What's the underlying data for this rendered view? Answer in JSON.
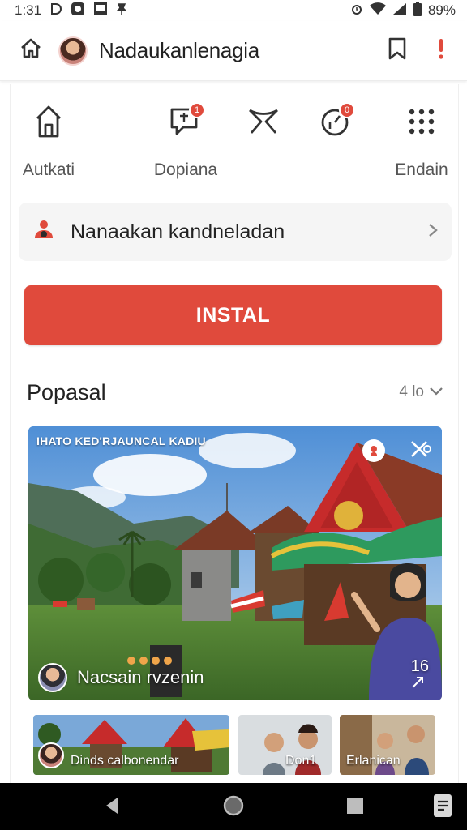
{
  "status_bar": {
    "time": "1:31",
    "left_icons": [
      "d-icon",
      "circle-app-icon",
      "image-icon",
      "pin-icon"
    ],
    "battery": "89%",
    "right_icons": [
      "alarm-icon",
      "wifi-icon",
      "signal-icon",
      "battery-icon"
    ]
  },
  "header": {
    "title": "Nadaukanlenagia",
    "icons": [
      "home-icon",
      "avatar",
      "bookmark-icon",
      "alert-icon"
    ]
  },
  "shortcuts": [
    {
      "label": "Autkati",
      "icon": "upload-icon",
      "badge": ""
    },
    {
      "label": "Dopiana",
      "icon": "chat-icon",
      "badge": "1"
    },
    {
      "label": "",
      "icon": "ribbon-icon",
      "badge": ""
    },
    {
      "label": "",
      "icon": "gauge-icon",
      "badge": "0"
    },
    {
      "label": "Endain",
      "icon": "grid-icon",
      "badge": ""
    }
  ],
  "profile_row": {
    "label": "Nanaakan kandneladan"
  },
  "install_button": {
    "label": "INSTAL"
  },
  "section": {
    "title": "Popasal",
    "more_label": "4 lo"
  },
  "hero": {
    "top_text": "IHATO KED'RJAUNCAL KADIU",
    "caption": "Nacsain rvzenin",
    "count": "16"
  },
  "thumbnails": [
    {
      "label": "Dinds calbonendar"
    },
    {
      "label": "Don1"
    },
    {
      "label": "Erlanican"
    }
  ],
  "colors": {
    "accent": "#e04a3c",
    "nav_bar": "#000000"
  }
}
